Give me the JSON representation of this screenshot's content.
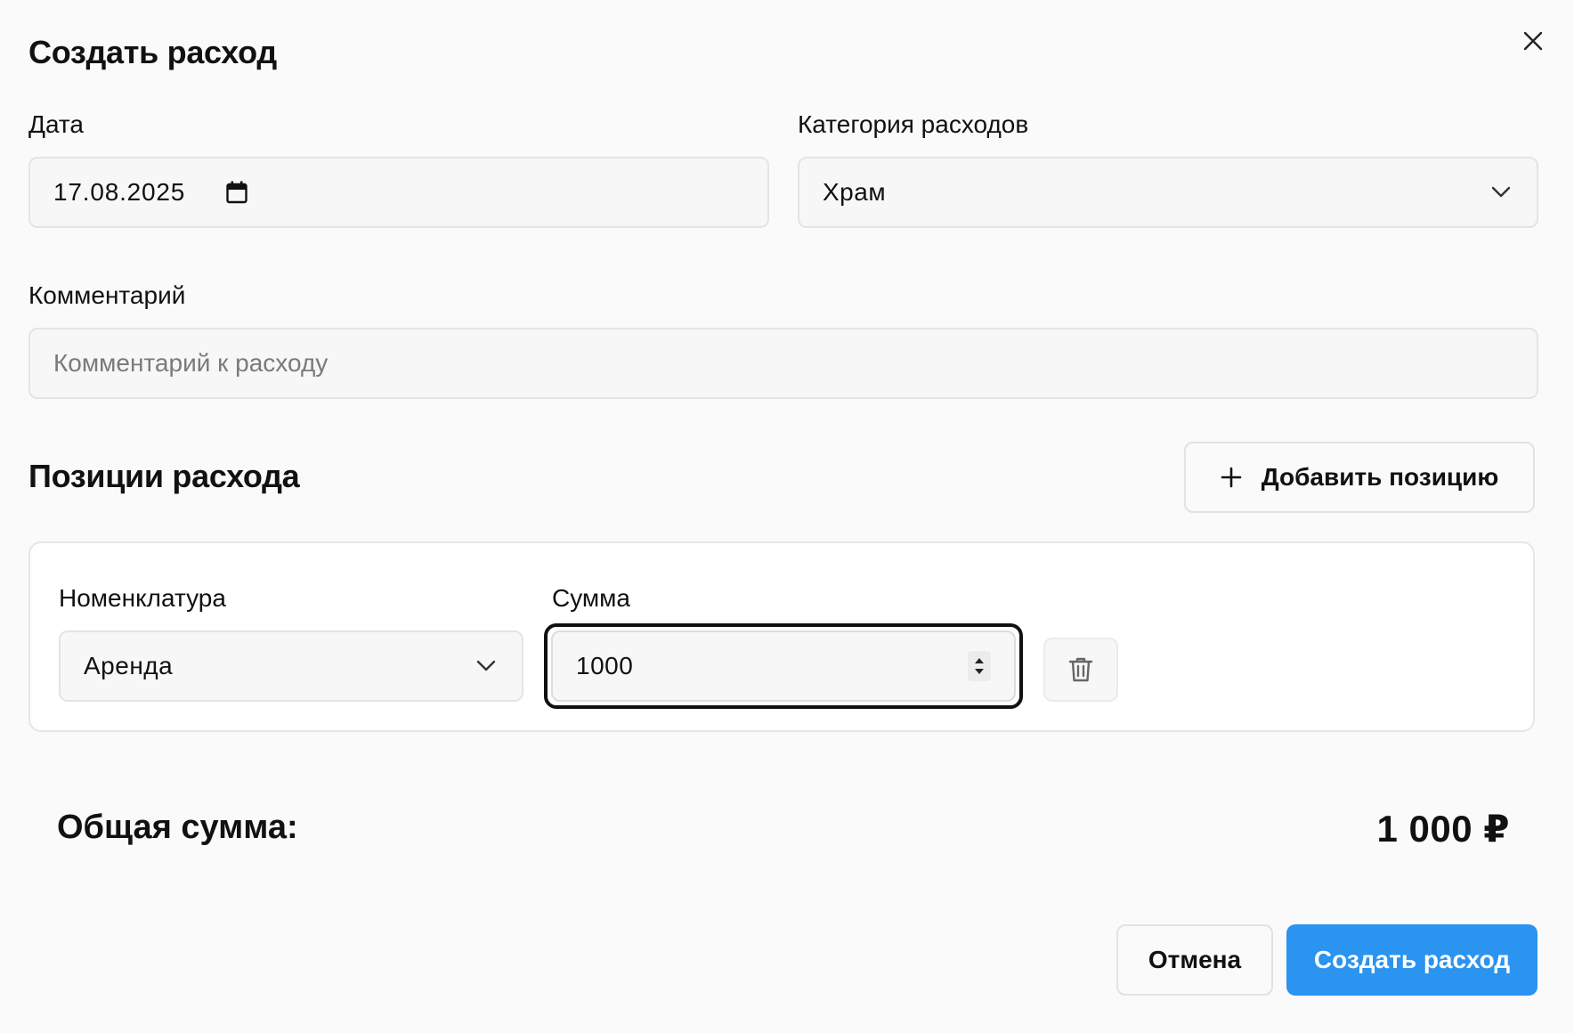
{
  "dialog": {
    "title": "Создать расход"
  },
  "date": {
    "label": "Дата",
    "value": "17.08.2025"
  },
  "category": {
    "label": "Категория расходов",
    "value": "Храм"
  },
  "comment": {
    "label": "Комментарий",
    "placeholder": "Комментарий к расходу",
    "value": ""
  },
  "positions": {
    "title": "Позиции расхода",
    "add_label": "Добавить позицию",
    "items": [
      {
        "nomenclature_label": "Номенклатура",
        "nomenclature_value": "Аренда",
        "amount_label": "Сумма",
        "amount_value": "1000"
      }
    ]
  },
  "total": {
    "label": "Общая сумма:",
    "value": "1 000 ₽"
  },
  "actions": {
    "cancel_label": "Отмена",
    "submit_label": "Создать расход"
  },
  "icons": {
    "close": "close-icon",
    "calendar": "calendar-icon",
    "chevron": "chevron-down-icon",
    "plus": "plus-icon",
    "stepper": "stepper-icon",
    "trash": "trash-icon"
  },
  "colors": {
    "primary": "#2a94f0",
    "background": "#fafafa",
    "card": "#ffffff",
    "text": "#111111",
    "placeholder": "#7a7a7a"
  }
}
